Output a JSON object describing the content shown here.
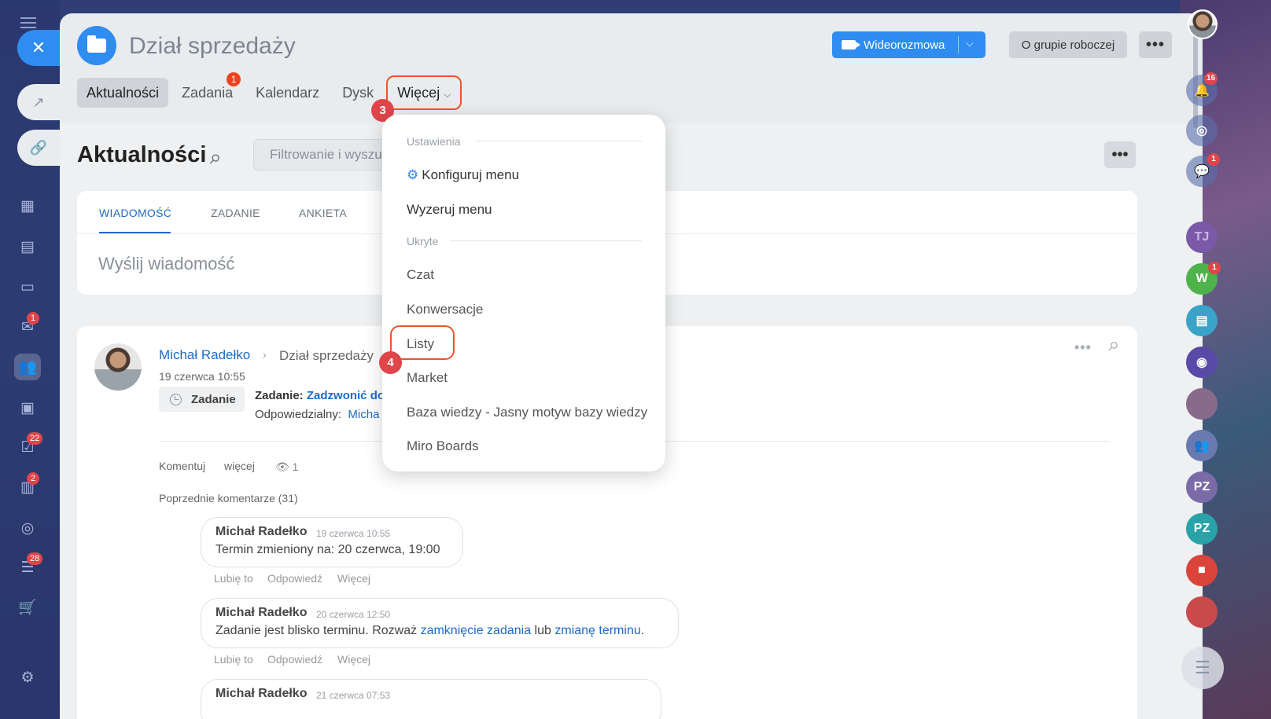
{
  "header": {
    "title": "Dział sprzedaży",
    "video_button": "Wideorozmowa",
    "group_button": "O grupie roboczej",
    "more_button": "•••"
  },
  "tabs": [
    {
      "label": "Aktualności",
      "active": true
    },
    {
      "label": "Zadania",
      "badge": "1"
    },
    {
      "label": "Kalendarz"
    },
    {
      "label": "Dysk"
    },
    {
      "label": "Więcej"
    }
  ],
  "steps": {
    "three": "3",
    "four": "4"
  },
  "feed": {
    "title": "Aktualności",
    "filter_placeholder": "Filtrowanie i wyszukiwanie",
    "more_button": "•••"
  },
  "composer": {
    "tabs": [
      "WIADOMOŚĆ",
      "ZADANIE",
      "ANKIETA"
    ],
    "placeholder": "Wyślij wiadomość"
  },
  "post": {
    "author": "Michał Radełko",
    "destination": "Dział sprzedaży",
    "date": "19 czerwca 10:55",
    "chip": "Zadanie",
    "task_prefix": "Zadanie:",
    "task_link": "Zadzwonić do",
    "responsible_label": "Odpowiedzialny:",
    "responsible_value": "Micha",
    "actions": {
      "comment": "Komentuj",
      "more": "więcej",
      "views": "1"
    },
    "previous_comments": "Poprzednie komentarze (31)",
    "comments": [
      {
        "author": "Michał Radełko",
        "date": "19 czerwca 10:55",
        "text": "Termin zmieniony na: 20 czerwca, 19:00"
      },
      {
        "author": "Michał Radełko",
        "date": "20 czerwca 12:50",
        "text_before": "Zadanie jest blisko terminu. Rozważ",
        "link1": "zamknięcie zadania",
        "text_mid": "lub",
        "link2": "zmianę terminu",
        "text_after": "."
      },
      {
        "author": "Michał Radełko",
        "date": "21 czerwca 07:53"
      }
    ],
    "comment_actions": {
      "like": "Lubię to",
      "reply": "Odpowiedź",
      "more": "Więcej"
    }
  },
  "menu": {
    "section_settings": "Ustawienia",
    "configure": "Konfiguruj menu",
    "reset": "Wyzeruj menu",
    "section_hidden": "Ukryte",
    "items": [
      "Czat",
      "Konwersacje",
      "Listy",
      "Market",
      "Baza wiedzy - Jasny motyw bazy wiedzy",
      "Miro Boards"
    ]
  },
  "left_badges": {
    "mail": "1",
    "tasks": "22",
    "crm": "2",
    "funnel": "28"
  },
  "right_rail": {
    "notifications_badge": "16",
    "chat_badge": "1",
    "w_avatar": "W",
    "w_badge": "1",
    "tj": "TJ",
    "pz1": "PZ",
    "pz2": "PZ"
  },
  "colors": {
    "accent": "#2f8cf0",
    "highlight": "#e9562c",
    "badge": "#e0454a",
    "link": "#1e6bc4"
  }
}
